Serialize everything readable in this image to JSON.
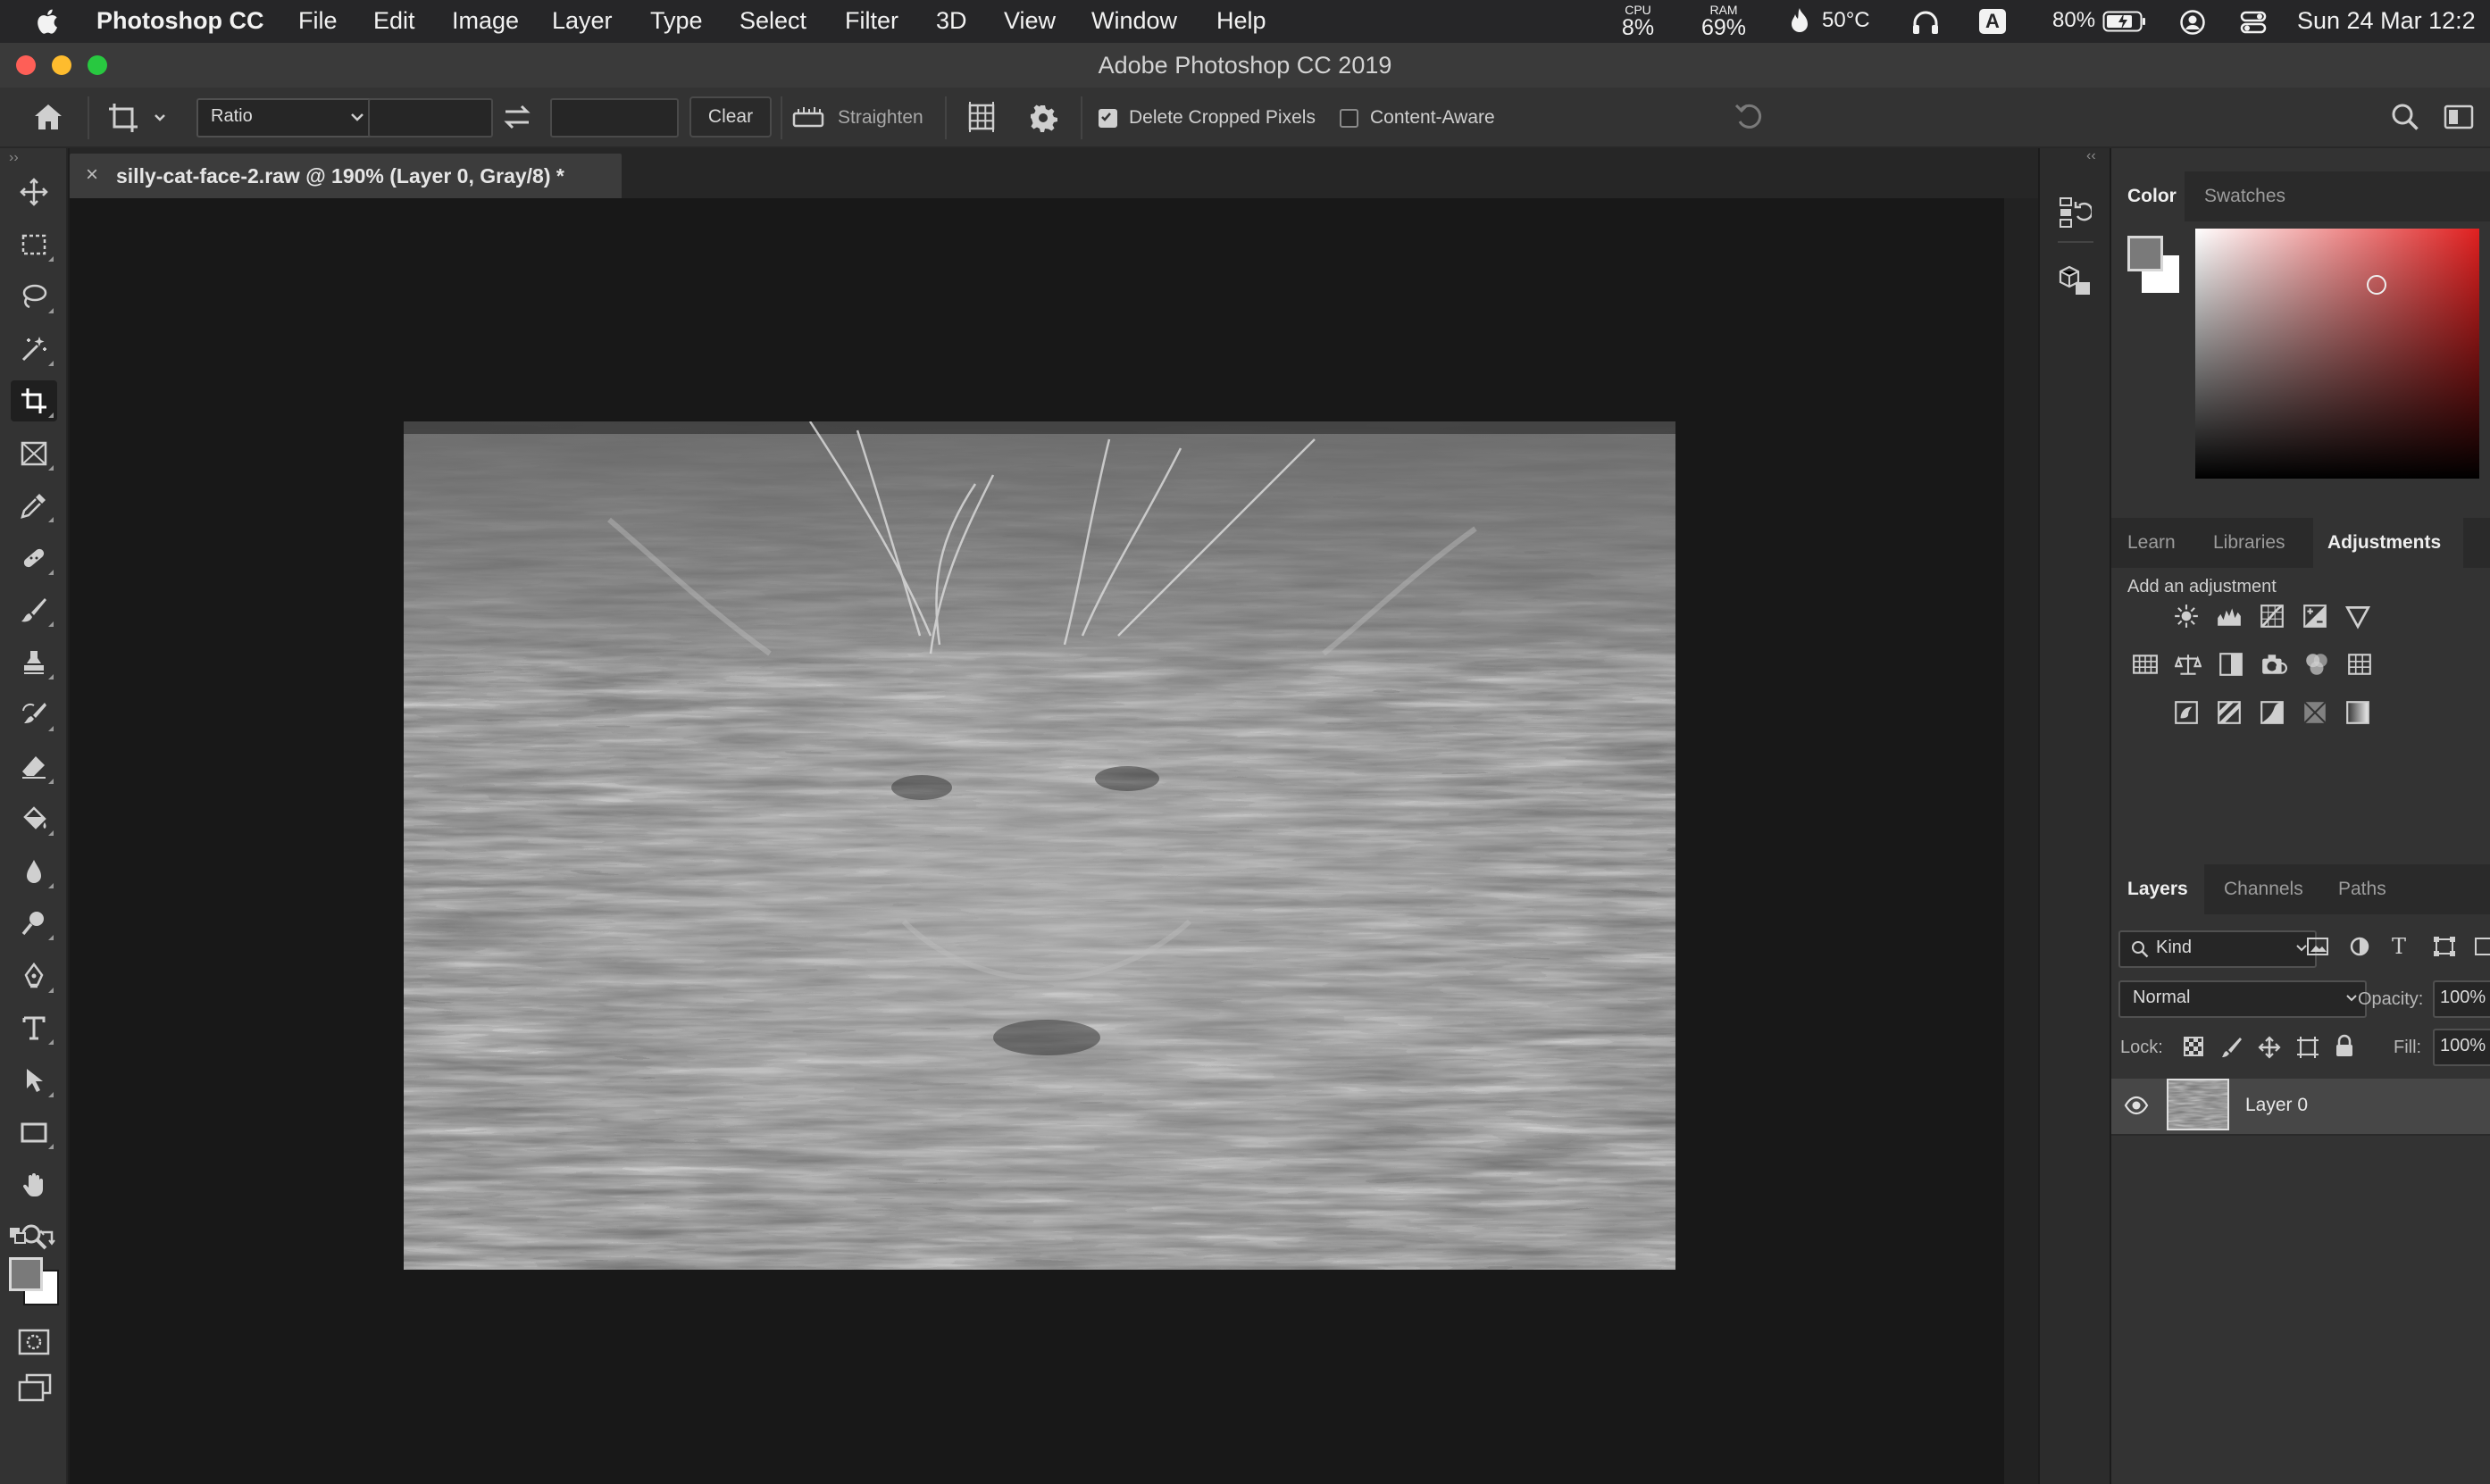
{
  "menubar": {
    "app_name": "Photoshop CC",
    "items": [
      "File",
      "Edit",
      "Image",
      "Layer",
      "Type",
      "Select",
      "Filter",
      "3D",
      "View",
      "Window",
      "Help"
    ],
    "cpu_label": "CPU",
    "cpu_value": "8%",
    "ram_label": "RAM",
    "ram_value": "69%",
    "temperature": "50°C",
    "input_badge": "A",
    "battery": "80%",
    "clock": "Sun 24 Mar  12:2"
  },
  "window": {
    "title": "Adobe Photoshop CC 2019"
  },
  "options_bar": {
    "ratio_preset": "Ratio",
    "width_value": "",
    "height_value": "",
    "clear_label": "Clear",
    "straighten_label": "Straighten",
    "delete_cropped_label": "Delete Cropped Pixels",
    "delete_cropped_checked": true,
    "content_aware_label": "Content-Aware",
    "content_aware_checked": false
  },
  "document": {
    "tab_title": "silly-cat-face-2.raw @ 190% (Layer 0, Gray/8) *",
    "close_glyph": "×"
  },
  "tools": [
    "move-tool",
    "marquee-tool",
    "lasso-tool",
    "magic-wand-tool",
    "crop-tool",
    "frame-tool",
    "eyedropper-tool",
    "healing-brush-tool",
    "brush-tool",
    "clone-stamp-tool",
    "history-brush-tool",
    "eraser-tool",
    "paint-bucket-tool",
    "blur-tool",
    "dodge-tool",
    "pen-tool",
    "type-tool",
    "path-selection-tool",
    "rectangle-tool",
    "hand-tool",
    "zoom-tool",
    "more-tools"
  ],
  "active_tool": "crop-tool",
  "colors": {
    "foreground": "#7a7a7a",
    "background": "#ffffff",
    "picker_hue": "#e02020"
  },
  "color_panel": {
    "tabs": [
      "Color",
      "Swatches"
    ],
    "active": "Color"
  },
  "adjustments_panel": {
    "tabs": [
      "Learn",
      "Libraries",
      "Adjustments"
    ],
    "active": "Adjustments",
    "heading": "Add an adjustment",
    "icons": [
      [
        "brightness-contrast",
        "levels",
        "curves",
        "exposure",
        "vibrance"
      ],
      [
        "hue-saturation",
        "color-balance",
        "black-white",
        "photo-filter",
        "channel-mixer",
        "color-lookup"
      ],
      [
        "invert",
        "posterize",
        "threshold",
        "selective-color",
        "gradient-map"
      ]
    ]
  },
  "layers_panel": {
    "tabs": [
      "Layers",
      "Channels",
      "Paths"
    ],
    "active": "Layers",
    "filter_kind": "Kind",
    "blend_mode": "Normal",
    "opacity_label": "Opacity:",
    "opacity_value": "100%",
    "lock_label": "Lock:",
    "fill_label": "Fill:",
    "fill_value": "100%",
    "layers": [
      {
        "name": "Layer 0",
        "visible": true
      }
    ]
  }
}
